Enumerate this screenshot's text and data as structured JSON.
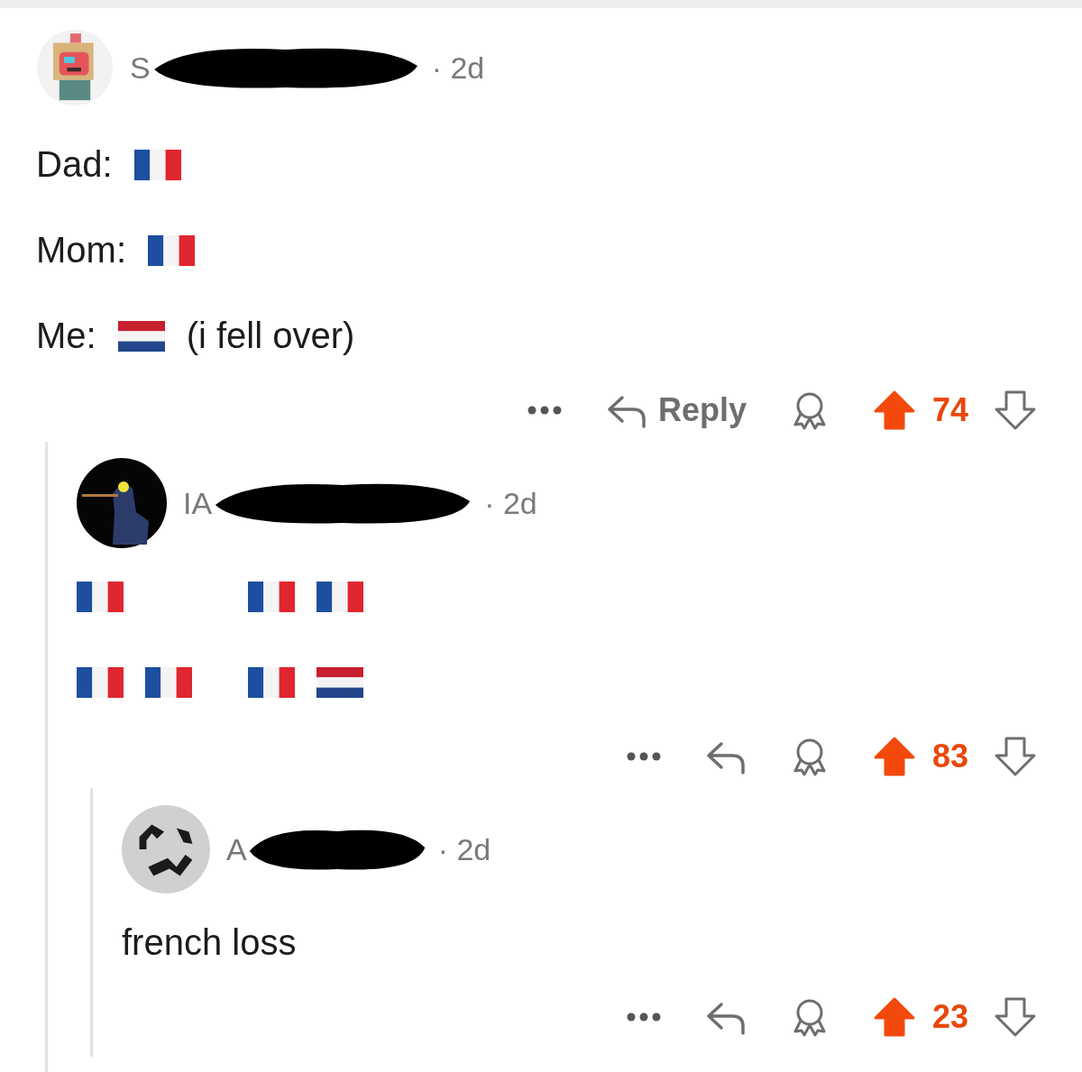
{
  "comments": [
    {
      "author": "S",
      "time": "· 2d",
      "body": [
        [
          {
            "kind": "text",
            "text": "Dad:"
          },
          {
            "kind": "france"
          }
        ],
        [
          {
            "kind": "text",
            "text": "Mom:"
          },
          {
            "kind": "france"
          }
        ],
        [
          {
            "kind": "text",
            "text": "Me:"
          },
          {
            "kind": "netherlands"
          },
          {
            "kind": "text",
            "text": "(i fell over)"
          }
        ]
      ],
      "reply_label": "Reply",
      "upvoted": true,
      "score": "74",
      "children": [
        {
          "author": "IA",
          "time": "· 2d",
          "body": [
            [
              {
                "kind": "france"
              },
              {
                "kind": "space"
              },
              {
                "kind": "space"
              },
              {
                "kind": "space"
              },
              {
                "kind": "france"
              },
              {
                "kind": "france"
              }
            ],
            [
              {
                "kind": "france"
              },
              {
                "kind": "france"
              },
              {
                "kind": "space"
              },
              {
                "kind": "france"
              },
              {
                "kind": "netherlands"
              }
            ]
          ],
          "upvoted": true,
          "score": "83",
          "children": [
            {
              "author": "A",
              "time": "· 2d",
              "body": [
                [
                  {
                    "kind": "text",
                    "text": "french loss"
                  }
                ]
              ],
              "upvoted": true,
              "score": "23"
            }
          ]
        }
      ]
    }
  ]
}
